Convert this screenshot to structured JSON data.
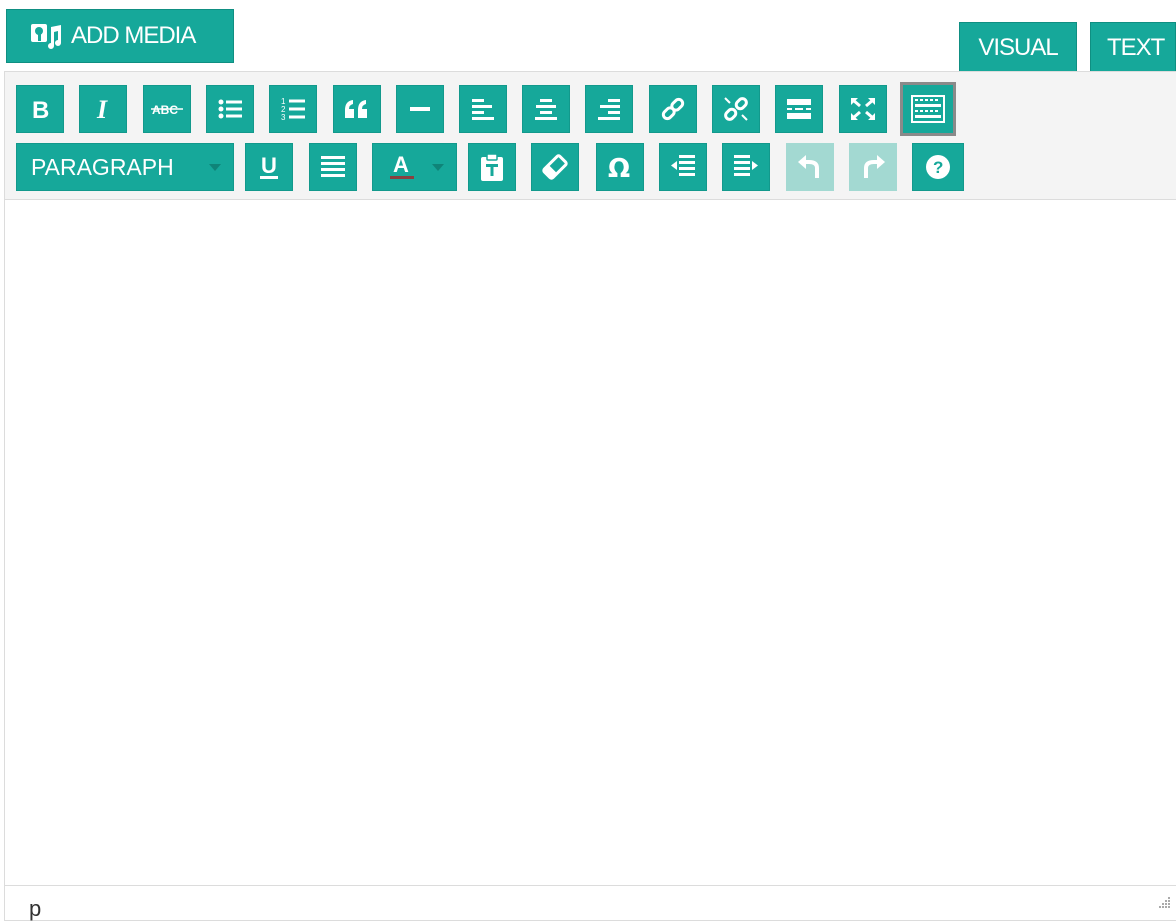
{
  "add_media": {
    "label": "ADD MEDIA",
    "icon": "media-icon"
  },
  "tabs": [
    {
      "label": "VISUAL"
    },
    {
      "label": "TEXT"
    }
  ],
  "toolbar": {
    "row1": [
      {
        "name": "bold",
        "icon": "bold-icon"
      },
      {
        "name": "italic",
        "icon": "italic-icon"
      },
      {
        "name": "strikethrough",
        "icon": "strikethrough-icon",
        "glyph": "ABC"
      },
      {
        "name": "bullet-list",
        "icon": "bullet-list-icon"
      },
      {
        "name": "numbered-list",
        "icon": "numbered-list-icon"
      },
      {
        "name": "blockquote",
        "icon": "blockquote-icon"
      },
      {
        "name": "horizontal-line",
        "icon": "horizontal-line-icon"
      },
      {
        "name": "align-left",
        "icon": "align-left-icon"
      },
      {
        "name": "align-center",
        "icon": "align-center-icon"
      },
      {
        "name": "align-right",
        "icon": "align-right-icon"
      },
      {
        "name": "insert-link",
        "icon": "link-icon"
      },
      {
        "name": "remove-link",
        "icon": "unlink-icon"
      },
      {
        "name": "read-more",
        "icon": "read-more-icon"
      },
      {
        "name": "fullscreen",
        "icon": "fullscreen-icon"
      },
      {
        "name": "toolbar-toggle",
        "icon": "keyboard-icon"
      }
    ],
    "row2": {
      "format_select": {
        "value": "PARAGRAPH"
      },
      "underline_glyph": "U",
      "text_color_glyph": "A",
      "special_char_glyph": "Ω",
      "help_glyph": "?"
    }
  },
  "statusbar": {
    "path": "p"
  },
  "colors": {
    "accent": "#16a89a",
    "accent_disabled": "#a3d9d2",
    "toolbar_bg": "#f4f4f4"
  }
}
